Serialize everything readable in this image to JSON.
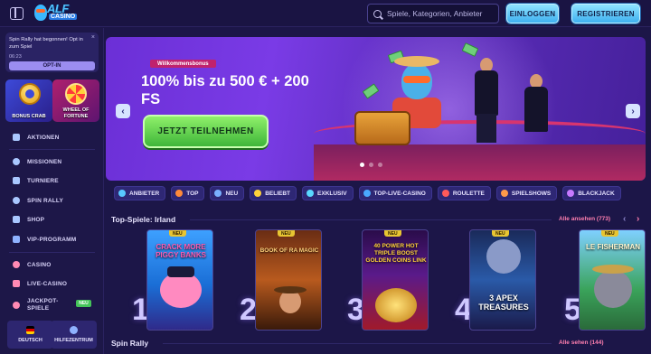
{
  "header": {
    "logo_main": "ALF",
    "logo_sub": "CASINO",
    "search_placeholder": "Spiele, Kategorien, Anbieter",
    "login_label": "EINLOGGEN",
    "register_label": "REGISTRIEREN"
  },
  "sidebar": {
    "promo": {
      "text": "Spin Rally hat begonnen! Opt in zum Spiel",
      "time": "06:23",
      "button": "OPT-IN",
      "close": "×"
    },
    "tiles": [
      {
        "label": "BONUS CRAB"
      },
      {
        "label": "WHEEL OF FORTUNE"
      }
    ],
    "items": [
      {
        "label": "AKTIONEN",
        "icon": "gift-icon"
      },
      {
        "label": "MISSIONEN",
        "icon": "rocket-icon"
      },
      {
        "label": "TURNIERE",
        "icon": "trophy-icon"
      },
      {
        "label": "SPIN RALLY",
        "icon": "rally-icon"
      },
      {
        "label": "SHOP",
        "icon": "shop-icon"
      },
      {
        "label": "VIP-PROGRAMM",
        "icon": "crown-icon"
      },
      {
        "label": "CASINO",
        "icon": "cherry-icon"
      },
      {
        "label": "LIVE-CASINO",
        "icon": "chip-icon"
      },
      {
        "label": "JACKPOT-SPIELE",
        "icon": "jackpot-icon"
      }
    ],
    "jackpot_badge": "NEU",
    "language_label": "DEUTSCH",
    "help_label": "HILFEZENTRUM"
  },
  "hero": {
    "tag": "Willkommensbonus",
    "title": "100% bis zu 500 € + 200 FS",
    "cta": "JETZT TEILNEHMEN",
    "prev": "‹",
    "next": "›",
    "slides": 3,
    "active_slide": 1
  },
  "categories": [
    {
      "label": "ANBIETER",
      "color": "#58c8ff"
    },
    {
      "label": "TOP",
      "color": "#ff8a3a"
    },
    {
      "label": "NEU",
      "color": "#7ab0ff"
    },
    {
      "label": "BELIEBT",
      "color": "#ffd23a"
    },
    {
      "label": "EXKLUSIV",
      "color": "#5ad8ff"
    },
    {
      "label": "TOP-LIVE-CASINO",
      "color": "#4aa8ff"
    },
    {
      "label": "ROULETTE",
      "color": "#ff5a5a"
    },
    {
      "label": "SPIELSHOWS",
      "color": "#ff9a4a"
    },
    {
      "label": "BLACKJACK",
      "color": "#c77aff"
    }
  ],
  "top_games": {
    "title": "Top-Spiele: Irland",
    "see_all": "Alle ansehen (773)",
    "prev": "‹",
    "next": "›",
    "badge": "NEU",
    "games": [
      {
        "rank": "1",
        "title": "CRACK MORE PIGGY BANKS"
      },
      {
        "rank": "2",
        "title": "BOOK OF RA MAGIC"
      },
      {
        "rank": "3",
        "title": "40 POWER HOT TRIPLE BOOST GOLDEN COINS LINK"
      },
      {
        "rank": "4",
        "title": "3 APEX TREASURES"
      },
      {
        "rank": "5",
        "title": "LE FISHERMAN"
      }
    ]
  },
  "spin_rally": {
    "title": "Spin Rally",
    "see_all": "Alle sehen (144)"
  }
}
